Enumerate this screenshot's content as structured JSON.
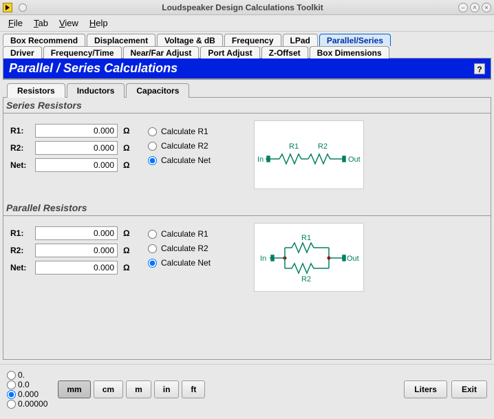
{
  "window": {
    "title": "Loudspeaker Design Calculations Toolkit"
  },
  "menu": {
    "file": "File",
    "tab": "Tab",
    "view": "View",
    "help": "Help"
  },
  "tabs_row1": [
    "Box Recommend",
    "Displacement",
    "Voltage & dB",
    "Frequency",
    "LPad",
    "Parallel/Series"
  ],
  "tabs_row2": [
    "Driver",
    "Frequency/Time",
    "Near/Far Adjust",
    "Port Adjust",
    "Z-Offset",
    "Box Dimensions"
  ],
  "tabs_active": "Parallel/Series",
  "panel": {
    "title": "Parallel / Series Calculations",
    "help": "?"
  },
  "subtabs": [
    "Resistors",
    "Inductors",
    "Capacitors"
  ],
  "subtabs_active": "Resistors",
  "series": {
    "title": "Series Resistors",
    "r1": {
      "label": "R1:",
      "value": "0.000",
      "unit": "Ω"
    },
    "r2": {
      "label": "R2:",
      "value": "0.000",
      "unit": "Ω"
    },
    "net": {
      "label": "Net:",
      "value": "0.000",
      "unit": "Ω"
    },
    "calc_r1": "Calculate R1",
    "calc_r2": "Calculate R2",
    "calc_net": "Calculate Net",
    "selected": "net",
    "diag": {
      "in": "In",
      "out": "Out",
      "r1": "R1",
      "r2": "R2"
    }
  },
  "parallel": {
    "title": "Parallel Resistors",
    "r1": {
      "label": "R1:",
      "value": "0.000",
      "unit": "Ω"
    },
    "r2": {
      "label": "R2:",
      "value": "0.000",
      "unit": "Ω"
    },
    "net": {
      "label": "Net:",
      "value": "0.000",
      "unit": "Ω"
    },
    "calc_r1": "Calculate R1",
    "calc_r2": "Calculate R2",
    "calc_net": "Calculate Net",
    "selected": "net",
    "diag": {
      "in": "In",
      "out": "Out",
      "r1": "R1",
      "r2": "R2"
    }
  },
  "precision": {
    "opts": [
      "0.",
      "0.0",
      "0.000",
      "0.00000"
    ],
    "selected": "0.000"
  },
  "units": {
    "opts": [
      "mm",
      "cm",
      "m",
      "in",
      "ft"
    ],
    "selected": "mm"
  },
  "buttons": {
    "liters": "Liters",
    "exit": "Exit"
  }
}
